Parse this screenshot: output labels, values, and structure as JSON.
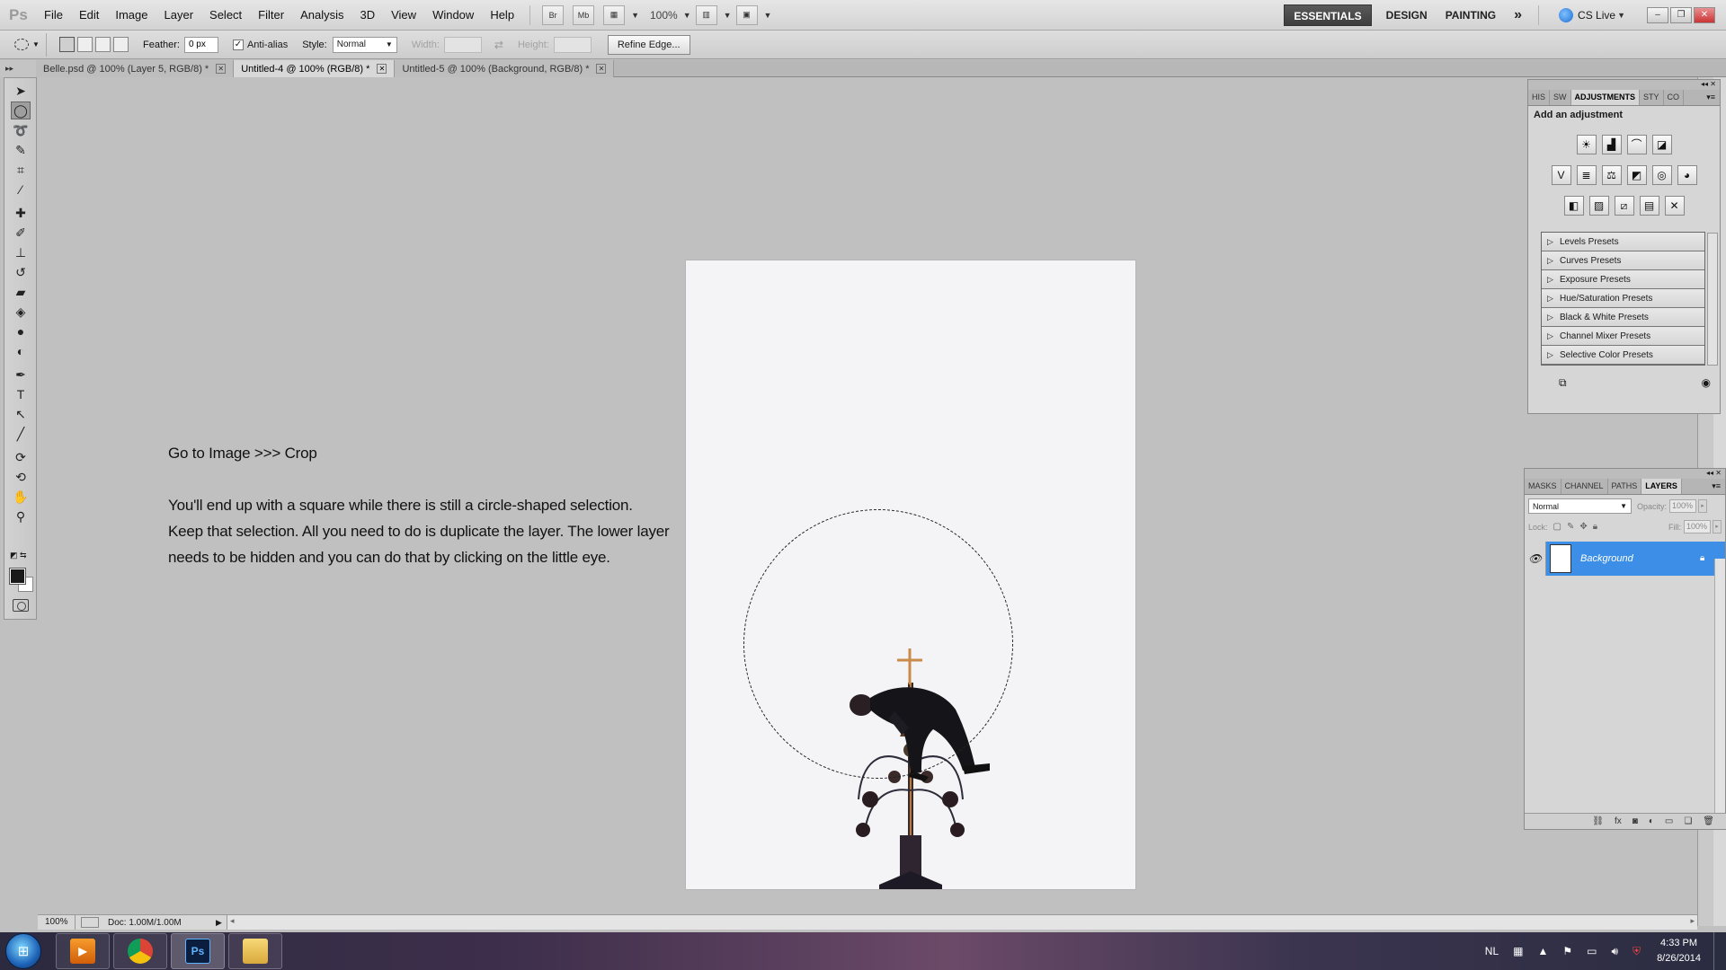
{
  "app": {
    "logo": "Ps",
    "menu": [
      "File",
      "Edit",
      "Image",
      "Layer",
      "Select",
      "Filter",
      "Analysis",
      "3D",
      "View",
      "Window",
      "Help"
    ],
    "bridge_label": "Br",
    "minibridge_label": "Mb",
    "zoom": "100%",
    "workspaces": [
      "ESSENTIALS",
      "DESIGN",
      "PAINTING"
    ],
    "workspace_more": "»",
    "cslive_label": "CS Live"
  },
  "options": {
    "feather_label": "Feather:",
    "feather_value": "0 px",
    "antialias_label": "Anti-alias",
    "antialias_checked": true,
    "style_label": "Style:",
    "style_value": "Normal",
    "width_label": "Width:",
    "height_label": "Height:",
    "refine_edge_label": "Refine Edge..."
  },
  "tabs": [
    {
      "label": "Belle.psd @ 100% (Layer 5, RGB/8) *",
      "active": false
    },
    {
      "label": "Untitled-4 @ 100% (RGB/8) *",
      "active": true
    },
    {
      "label": "Untitled-5 @ 100% (Background, RGB/8) *",
      "active": false
    }
  ],
  "instructions": {
    "line1": "Go to Image >>> Crop",
    "paragraph2": "You'll end up with a square while there is still a circle-shaped selection. Keep that selection. All you need to do is duplicate the layer. The lower layer needs to be hidden and you can do that by clicking on the little eye."
  },
  "status": {
    "zoom": "100%",
    "doc_info": "Doc: 1.00M/1.00M"
  },
  "adjustments": {
    "tabs": [
      "HIS",
      "SW",
      "ADJUSTMENTS",
      "STY",
      "CO"
    ],
    "active_tab": "ADJUSTMENTS",
    "title": "Add an adjustment",
    "presets": [
      "Levels Presets",
      "Curves Presets",
      "Exposure Presets",
      "Hue/Saturation Presets",
      "Black & White Presets",
      "Channel Mixer Presets",
      "Selective Color Presets"
    ]
  },
  "layers": {
    "tabs": [
      "MASKS",
      "CHANNEL",
      "PATHS",
      "LAYERS"
    ],
    "active_tab": "LAYERS",
    "blend_mode": "Normal",
    "opacity_label": "Opacity:",
    "opacity_value": "100%",
    "lock_label": "Lock:",
    "fill_label": "Fill:",
    "fill_value": "100%",
    "items": [
      {
        "name": "Background",
        "selected": true,
        "visible": true,
        "locked": true
      }
    ]
  },
  "taskbar": {
    "language": "NL",
    "time": "4:33 PM",
    "date": "8/26/2014"
  },
  "colors": {
    "layer_selected": "#3d8ee6",
    "workspace_bg": "#c0c0c0",
    "document_bg": "#f4f4f6"
  }
}
